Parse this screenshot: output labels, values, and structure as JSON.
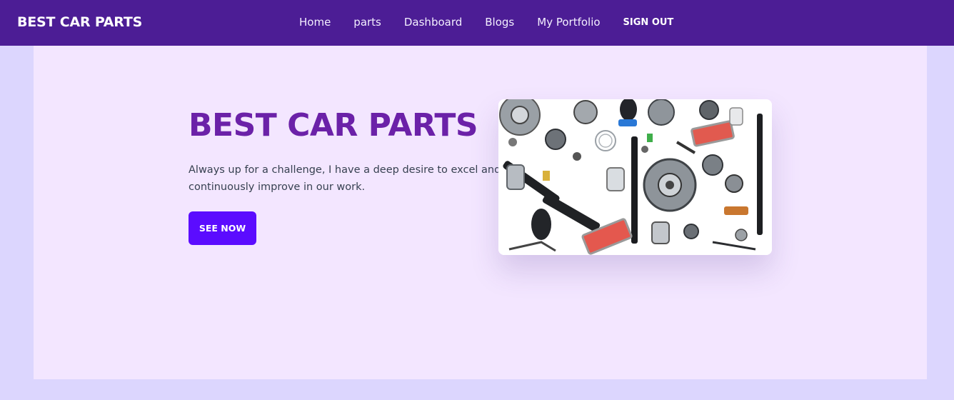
{
  "navbar": {
    "brand": "BEST CAR PARTS",
    "links": [
      {
        "label": "Home"
      },
      {
        "label": "parts"
      },
      {
        "label": "Dashboard"
      },
      {
        "label": "Blogs"
      },
      {
        "label": "My Portfolio"
      }
    ],
    "signout_label": "SIGN OUT"
  },
  "hero": {
    "title": "BEST CAR PARTS",
    "description": "Always up for a challenge, I have a deep desire to excel and continuously improve in our work.",
    "button_label": "SEE NOW",
    "image_icon": "car-parts-collage"
  },
  "colors": {
    "navbar_bg": "#4c1d95",
    "page_bg": "#dcd6fe",
    "panel_bg": "#f3e6ff",
    "title": "#6b21a8",
    "button_bg": "#5b0cff"
  }
}
